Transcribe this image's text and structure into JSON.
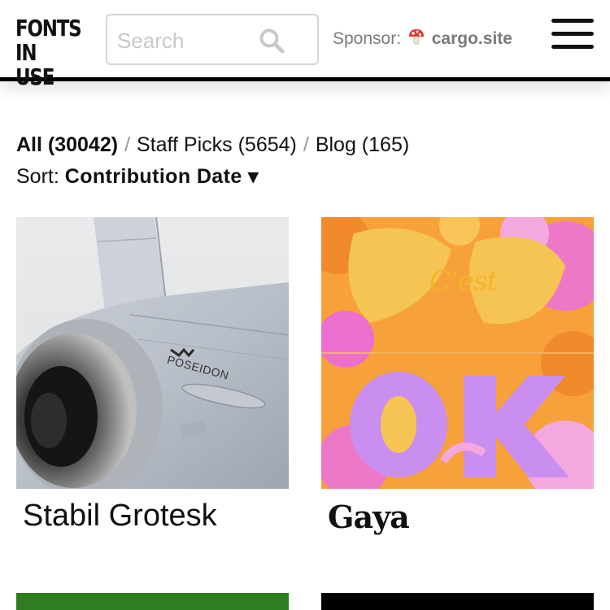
{
  "header": {
    "logo_line1": "FONTS",
    "logo_line2": "IN USE",
    "search_placeholder": "Search",
    "sponsor_label": "Sponsor:",
    "sponsor_name": "cargo.site"
  },
  "filters": {
    "all": "All (30042)",
    "sep1": "/",
    "staff_picks": "Staff Picks (5654)",
    "sep2": "/",
    "blog": "Blog (165)"
  },
  "sort": {
    "label": "Sort:",
    "value": "Contribution Date ▾"
  },
  "cards": [
    {
      "title": "Stabil Grotesk",
      "image_text": "POSEIDON"
    },
    {
      "title": "Gaya",
      "image_text": "C’est"
    }
  ],
  "colors": {
    "card3_top": "#2e7d1f",
    "card4_top": "#000000"
  },
  "icons": {
    "search": "magnifier",
    "menu": "hamburger",
    "sponsor": "mushroom"
  }
}
